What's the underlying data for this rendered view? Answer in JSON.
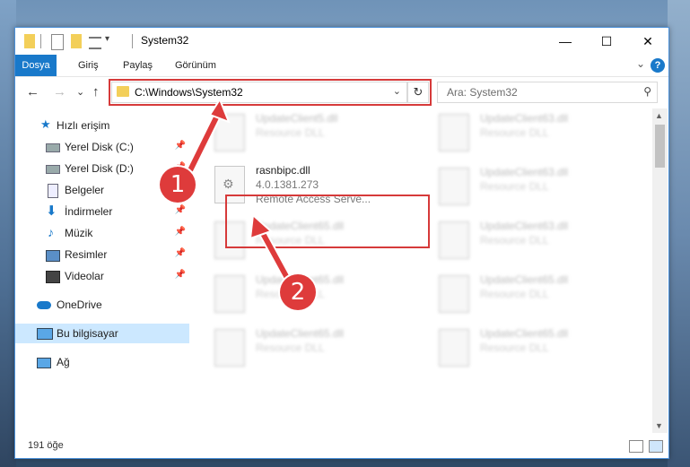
{
  "window": {
    "title": "System32",
    "controls": {
      "minimize": "—",
      "maximize": "☐",
      "close": "✕"
    }
  },
  "ribbon": {
    "tabs": [
      {
        "label": "Dosya",
        "active": true
      },
      {
        "label": "Giriş"
      },
      {
        "label": "Paylaş"
      },
      {
        "label": "Görünüm"
      }
    ],
    "help": "?",
    "collapse": "⌄"
  },
  "navbar": {
    "back": "←",
    "forward": "→",
    "recent": "⌄",
    "up": "↑",
    "address": "C:\\Windows\\System32",
    "address_dropdown": "⌄",
    "refresh": "↻",
    "search_placeholder": "Ara: System32",
    "search_icon": "⚲"
  },
  "sidebar": {
    "items": [
      {
        "label": "Hızlı erişim",
        "icon": "star-icon",
        "pinned": false
      },
      {
        "label": "Yerel Disk (C:)",
        "icon": "drive-icon",
        "pinned": true
      },
      {
        "label": "Yerel Disk (D:)",
        "icon": "drive-icon",
        "pinned": true
      },
      {
        "label": "Belgeler",
        "icon": "documents-icon",
        "pinned": true
      },
      {
        "label": "İndirmeler",
        "icon": "download-icon",
        "pinned": true
      },
      {
        "label": "Müzik",
        "icon": "music-icon",
        "pinned": true
      },
      {
        "label": "Resimler",
        "icon": "pictures-icon",
        "pinned": true
      },
      {
        "label": "Videolar",
        "icon": "videos-icon",
        "pinned": true
      },
      {
        "label": "OneDrive",
        "icon": "cloud-icon",
        "pinned": false
      },
      {
        "label": "Bu bilgisayar",
        "icon": "computer-icon",
        "pinned": false,
        "selected": true
      },
      {
        "label": "Ağ",
        "icon": "network-icon",
        "pinned": false
      }
    ]
  },
  "files": {
    "focus": {
      "name": "rasnbipc.dll",
      "version": "4.0.1381.273",
      "description": "Remote Access Serve..."
    },
    "blurred_left": [
      {
        "name": "UpdateClient5.dll",
        "desc": "Resource DLL"
      },
      {
        "name": "UpdateClient65.dll",
        "desc": "Resource DLL"
      },
      {
        "name": "UpdateClient65.dll",
        "desc": "Resource DLL"
      },
      {
        "name": "UpdateClient65.dll",
        "desc": "Resource DLL"
      }
    ],
    "blurred_right": [
      {
        "name": "UpdateClient63.dll",
        "desc": "Resource DLL"
      },
      {
        "name": "UpdateClient63.dll",
        "desc": "Resource DLL"
      },
      {
        "name": "UpdateClient63.dll",
        "desc": "Resource DLL"
      },
      {
        "name": "UpdateClient65.dll",
        "desc": "Resource DLL"
      },
      {
        "name": "UpdateClient65.dll",
        "desc": "Resource DLL"
      }
    ]
  },
  "status": {
    "count": "191 öğe"
  },
  "markers": [
    "1",
    "2"
  ],
  "colors": {
    "accent": "#1979ca",
    "highlight": "#d63a3a",
    "selected": "#cce8ff"
  }
}
